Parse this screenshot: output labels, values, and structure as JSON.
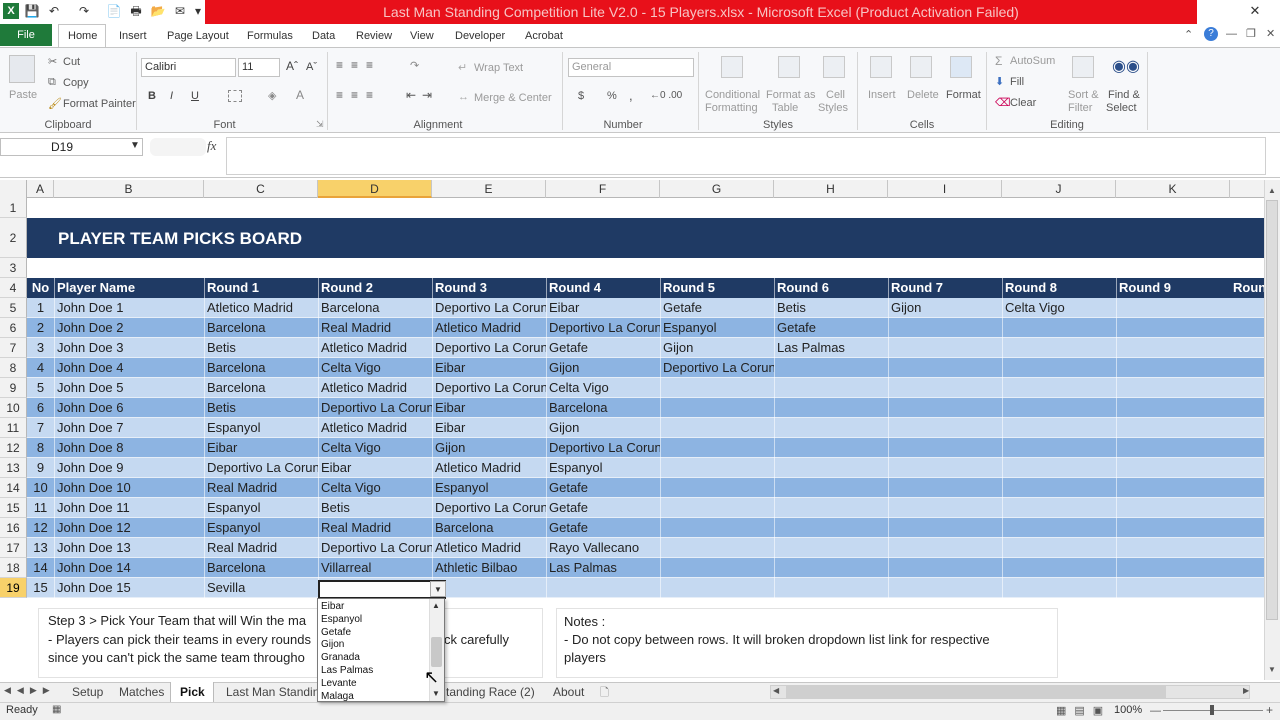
{
  "window": {
    "title": "Last Man Standing Competition Lite V2.0 - 15 Players.xlsx - Microsoft Excel (Product Activation Failed)"
  },
  "ribbon": {
    "tabs": [
      "File",
      "Home",
      "Insert",
      "Page Layout",
      "Formulas",
      "Data",
      "Review",
      "View",
      "Developer",
      "Acrobat"
    ],
    "clipboard": {
      "paste": "Paste",
      "cut": "Cut",
      "copy": "Copy",
      "format_painter": "Format Painter",
      "group": "Clipboard"
    },
    "font": {
      "name": "Calibri",
      "size": "11",
      "bold": "B",
      "italic": "I",
      "underline": "U",
      "group": "Font"
    },
    "alignment": {
      "wrap": "Wrap Text",
      "merge": "Merge & Center",
      "group": "Alignment"
    },
    "number": {
      "format": "General",
      "currency": "$",
      "percent": "%",
      "comma": ",",
      "group": "Number"
    },
    "styles": {
      "conditional": "Conditional",
      "formatting": "Formatting",
      "format_as": "Format as",
      "table": "Table",
      "cell": "Cell",
      "styles_label": "Styles",
      "group": "Styles"
    },
    "cells": {
      "insert": "Insert",
      "delete": "Delete",
      "format": "Format",
      "group": "Cells"
    },
    "editing": {
      "autosum": "AutoSum",
      "fill": "Fill",
      "clear": "Clear",
      "sort": "Sort &",
      "filter": "Filter",
      "find": "Find &",
      "select": "Select",
      "group": "Editing"
    }
  },
  "formula_bar": {
    "name_box": "D19",
    "fx": "fx",
    "content": ""
  },
  "columns": [
    "A",
    "B",
    "C",
    "D",
    "E",
    "F",
    "G",
    "H",
    "I",
    "J",
    "K"
  ],
  "row_numbers": [
    "1",
    "2",
    "3",
    "4",
    "5",
    "6",
    "7",
    "8",
    "9",
    "10",
    "11",
    "12",
    "13",
    "14",
    "15",
    "16",
    "17",
    "18",
    "19"
  ],
  "board": {
    "title": "PLAYER TEAM PICKS BOARD",
    "headers": [
      "No",
      "Player Name",
      "Round 1",
      "Round 2",
      "Round 3",
      "Round 4",
      "Round 5",
      "Round 6",
      "Round 7",
      "Round 8",
      "Round 9",
      "Roun"
    ],
    "rows": [
      [
        "1",
        "John Doe 1",
        "Atletico Madrid",
        "Barcelona",
        "Deportivo La Coruna",
        "Eibar",
        "Getafe",
        "Betis",
        "Gijon",
        "Celta Vigo",
        ""
      ],
      [
        "2",
        "John Doe 2",
        "Barcelona",
        "Real Madrid",
        "Atletico Madrid",
        "Deportivo La Coruna",
        "Espanyol",
        "Getafe",
        "",
        "",
        ""
      ],
      [
        "3",
        "John Doe 3",
        "Betis",
        "Atletico Madrid",
        "Deportivo La Coruna",
        "Getafe",
        "Gijon",
        "Las Palmas",
        "",
        "",
        ""
      ],
      [
        "4",
        "John Doe 4",
        "Barcelona",
        "Celta Vigo",
        "Eibar",
        "Gijon",
        "Deportivo La Coruna",
        "",
        "",
        "",
        ""
      ],
      [
        "5",
        "John Doe 5",
        "Barcelona",
        "Atletico Madrid",
        "Deportivo La Coruna",
        "Celta Vigo",
        "",
        "",
        "",
        "",
        ""
      ],
      [
        "6",
        "John Doe 6",
        "Betis",
        "Deportivo La Coruna",
        "Eibar",
        "Barcelona",
        "",
        "",
        "",
        "",
        ""
      ],
      [
        "7",
        "John Doe 7",
        "Espanyol",
        "Atletico Madrid",
        "Eibar",
        "Gijon",
        "",
        "",
        "",
        "",
        ""
      ],
      [
        "8",
        "John Doe 8",
        "Eibar",
        "Celta Vigo",
        "Gijon",
        "Deportivo La Coruna",
        "",
        "",
        "",
        "",
        ""
      ],
      [
        "9",
        "John Doe 9",
        "Deportivo La Coruna",
        "Eibar",
        "Atletico Madrid",
        "Espanyol",
        "",
        "",
        "",
        "",
        ""
      ],
      [
        "10",
        "John Doe 10",
        "Real Madrid",
        "Celta Vigo",
        "Espanyol",
        "Getafe",
        "",
        "",
        "",
        "",
        ""
      ],
      [
        "11",
        "John Doe 11",
        "Espanyol",
        "Betis",
        "Deportivo La Coruna",
        "Getafe",
        "",
        "",
        "",
        "",
        ""
      ],
      [
        "12",
        "John Doe 12",
        "Espanyol",
        "Real Madrid",
        "Barcelona",
        "Getafe",
        "",
        "",
        "",
        "",
        ""
      ],
      [
        "13",
        "John Doe 13",
        "Real Madrid",
        "Deportivo La Coruna",
        "Atletico Madrid",
        "Rayo Vallecano",
        "",
        "",
        "",
        "",
        ""
      ],
      [
        "14",
        "John Doe 14",
        "Barcelona",
        "Villarreal",
        "Athletic Bilbao",
        "Las Palmas",
        "",
        "",
        "",
        "",
        ""
      ],
      [
        "15",
        "John Doe 15",
        "Sevilla",
        "",
        "",
        "",
        "",
        "",
        "",
        "",
        ""
      ]
    ]
  },
  "step_box": {
    "line1": "Step 3 > Pick Your Team that will Win the ma",
    "line2a": "- Players can pick their teams in every rounds",
    "line2b": "ck carefully",
    "line3": "since you can't pick the same team througho"
  },
  "notes_box": {
    "title": "Notes :",
    "line1": "- Do not copy between rows. It will broken dropdown list link for respective",
    "line2": "players"
  },
  "dropdown": {
    "items": [
      "Eibar",
      "Espanyol",
      "Getafe",
      "Gijon",
      "Granada",
      "Las Palmas",
      "Levante",
      "Malaga"
    ]
  },
  "sheet_tabs": [
    "Setup",
    "Matches",
    "Pick",
    "Last Man Standin",
    "tanding Race (2)",
    "About"
  ],
  "status": {
    "ready": "Ready",
    "zoom": "100%"
  },
  "colors": {
    "header_navy": "#1f3a64",
    "band_dark": "#8db4e2",
    "band_light": "#c5d9f1",
    "title_red": "#e8101a",
    "file_green": "#1f7a3a"
  }
}
